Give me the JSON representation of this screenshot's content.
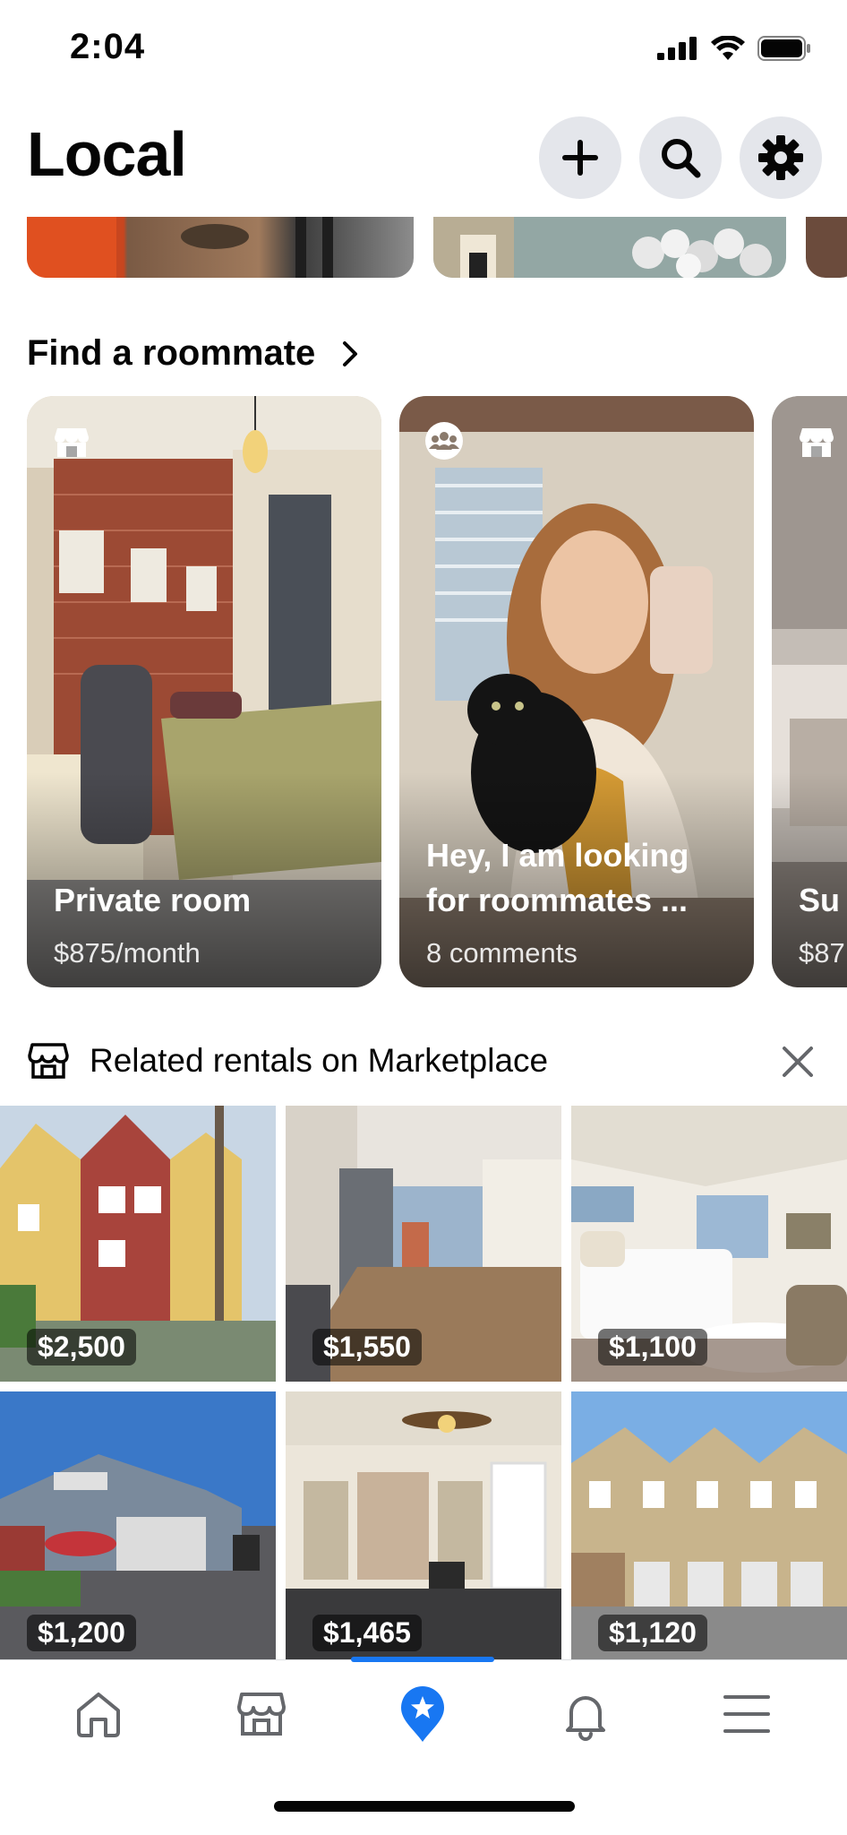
{
  "status_bar": {
    "time": "2:04"
  },
  "header": {
    "title": "Local"
  },
  "roommate_section": {
    "title": "Find a roommate",
    "cards": [
      {
        "title_line1": "Private room",
        "title_line2": "",
        "subtitle": "$875/month",
        "badge": "marketplace-icon"
      },
      {
        "title_line1": "Hey, I am looking",
        "title_line2": "for roommates ...",
        "subtitle": "8 comments",
        "badge": "group-icon"
      },
      {
        "title_line1": "Su",
        "title_line2": "",
        "subtitle": "$87",
        "badge": "marketplace-icon"
      }
    ]
  },
  "related": {
    "title": "Related rentals on Marketplace",
    "listings": [
      {
        "price": "$2,500"
      },
      {
        "price": "$1,550"
      },
      {
        "price": "$1,100"
      },
      {
        "price": "$1,200"
      },
      {
        "price": "$1,465"
      },
      {
        "price": "$1,120"
      }
    ]
  },
  "nav": {
    "items": [
      "home-icon",
      "marketplace-icon",
      "local-icon",
      "notifications-icon",
      "menu-icon"
    ],
    "active": "local-icon"
  },
  "colors": {
    "accent": "#1877f2",
    "button_bg": "#e4e6eb",
    "text": "#050505"
  }
}
